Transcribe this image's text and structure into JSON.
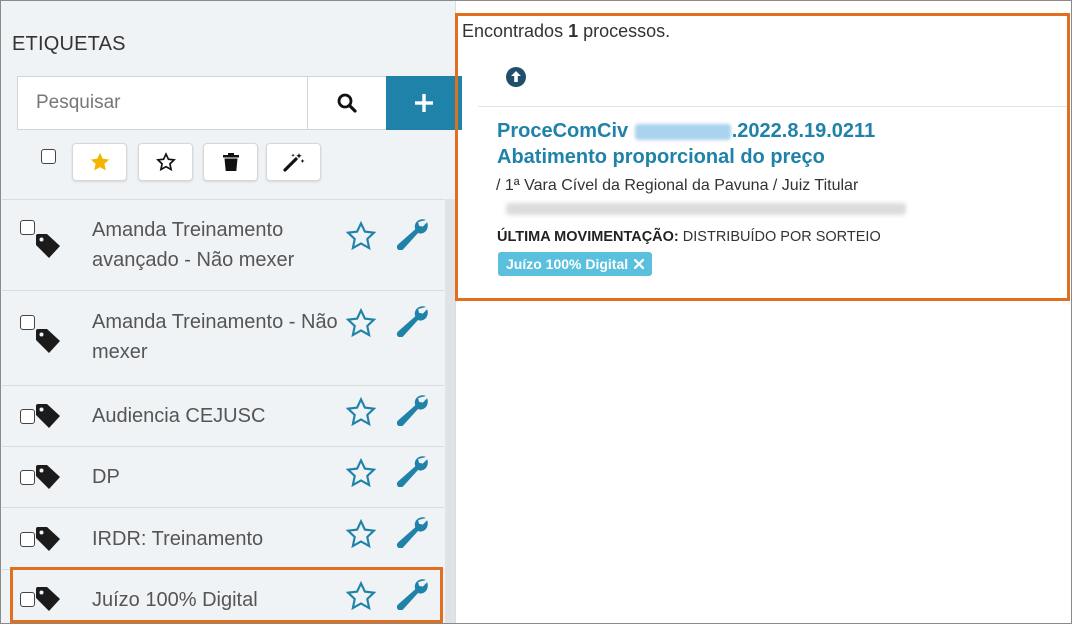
{
  "sidebar": {
    "title": "ETIQUETAS",
    "search": {
      "placeholder": "Pesquisar",
      "value": ""
    },
    "items": [
      {
        "label": "Amanda Treinamento avançado - Não mexer"
      },
      {
        "label": "Amanda Treinamento - Não mexer"
      },
      {
        "label": "Audiencia CEJUSC"
      },
      {
        "label": "DP"
      },
      {
        "label": "IRDR: Treinamento"
      },
      {
        "label": "Juízo 100% Digital"
      }
    ]
  },
  "results": {
    "found_prefix": "Encontrados",
    "found_count": "1",
    "found_suffix": "processos.",
    "process": {
      "class_code": "ProceComCiv",
      "number_suffix": ".2022.8.19.0211",
      "subject": "Abatimento proporcional do preço",
      "organ": "/ 1ª Vara Cível da Regional da Pavuna / Juiz Titular",
      "last_movement_label": "ÚLTIMA MOVIMENTAÇÃO:",
      "last_movement_value": "DISTRIBUÍDO POR SORTEIO",
      "tag": "Juízo 100% Digital"
    }
  },
  "colors": {
    "accent": "#1f82a8",
    "chip": "#5bc0de",
    "highlight": "#e07020",
    "favorite": "#f4b400"
  }
}
